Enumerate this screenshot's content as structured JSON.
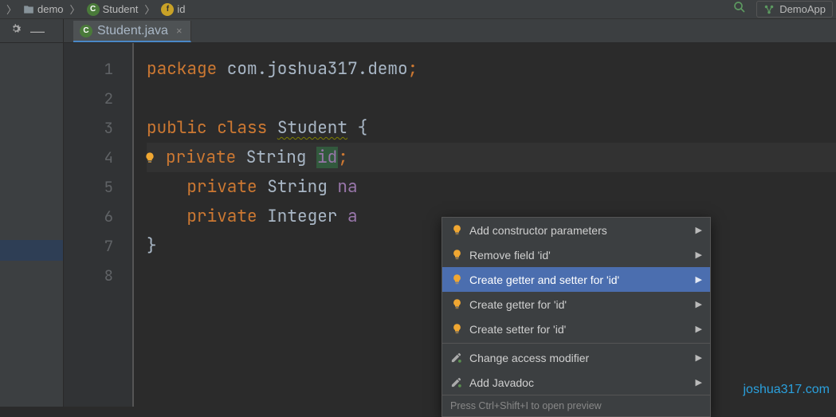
{
  "breadcrumb": {
    "seg0": "demo",
    "seg1": "Student",
    "seg2": "id",
    "class_icon_letter": "C",
    "field_icon_letter": "f"
  },
  "run_config": {
    "label": "DemoApp"
  },
  "tab": {
    "icon_letter": "C",
    "label": "Student.java"
  },
  "gutter": {
    "l1": "1",
    "l2": "2",
    "l3": "3",
    "l4": "4",
    "l5": "5",
    "l6": "6",
    "l7": "7",
    "l8": "8"
  },
  "code": {
    "kw_package": "package",
    "pkg_name": " com.joshua317.demo",
    "semicolon": ";",
    "kw_public": "public",
    "kw_class": " class ",
    "class_name": "Student",
    "brace_open": " {",
    "kw_private": "private",
    "type_string": " String ",
    "type_integer": " Integer ",
    "fld_id": "id",
    "fld_name_partial": "na",
    "fld_age_partial": "a",
    "brace_close": "}",
    "indent1": "    ",
    "space": " "
  },
  "popup": {
    "items": [
      {
        "icon": "bulb",
        "label": "Add constructor parameters"
      },
      {
        "icon": "bulb",
        "label": "Remove field 'id'"
      },
      {
        "icon": "bulb",
        "label": "Create getter and setter for 'id'"
      },
      {
        "icon": "bulb",
        "label": "Create getter for 'id'"
      },
      {
        "icon": "bulb",
        "label": "Create setter for 'id'"
      }
    ],
    "items2": [
      {
        "icon": "action",
        "label": "Change access modifier"
      },
      {
        "icon": "action",
        "label": "Add Javadoc"
      }
    ],
    "hint": "Press Ctrl+Shift+I to open preview",
    "selected_index": 2
  },
  "watermark": "joshua317.com"
}
